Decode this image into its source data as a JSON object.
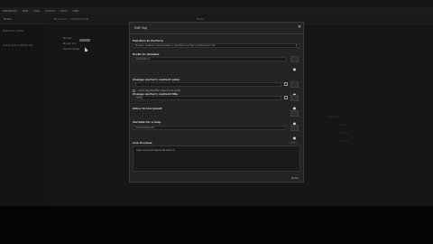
{
  "menu": [
    "MarkSharp",
    "Edit",
    "View",
    "Actions",
    "Tools",
    "Help"
  ],
  "toolbar": {
    "title": "Notes",
    "doc": "Bryan 2.1 - Untitled Draft",
    "mid": "Notes"
  },
  "sidebar": {
    "items": [
      "Research Alpha",
      "Subscription Notes Q3"
    ]
  },
  "tree": [
    "Nodes",
    "Bryan 2.1",
    "Alpha Notes"
  ],
  "right_texts": [
    "Untitled 3",
    "item 12",
    "item 14",
    "item 19"
  ],
  "modal": {
    "title": "Edit Tag",
    "function_label": "Function to Perform",
    "function_value": "Enable / Disable content based on whether any tag conditions are met",
    "prefix_label": "Prefix to Variable",
    "prefix_value": "AnswerNone",
    "checkbox_label": "Insert tag identifier value as its prefix",
    "change_label": "Change anchor's content value",
    "change_value": "1",
    "change2_label": "Change anchor's content title",
    "change2_value": "10000",
    "text_label": "Inline To Increment",
    "rule_label": "Variable for a loop",
    "rule_value": "ContentValue.tid",
    "preview_label": "Live Preview",
    "preview_value": "Options.bind(TAG@VALUE.total.id)",
    "copy_label": "copy",
    "done_label": "Done"
  }
}
